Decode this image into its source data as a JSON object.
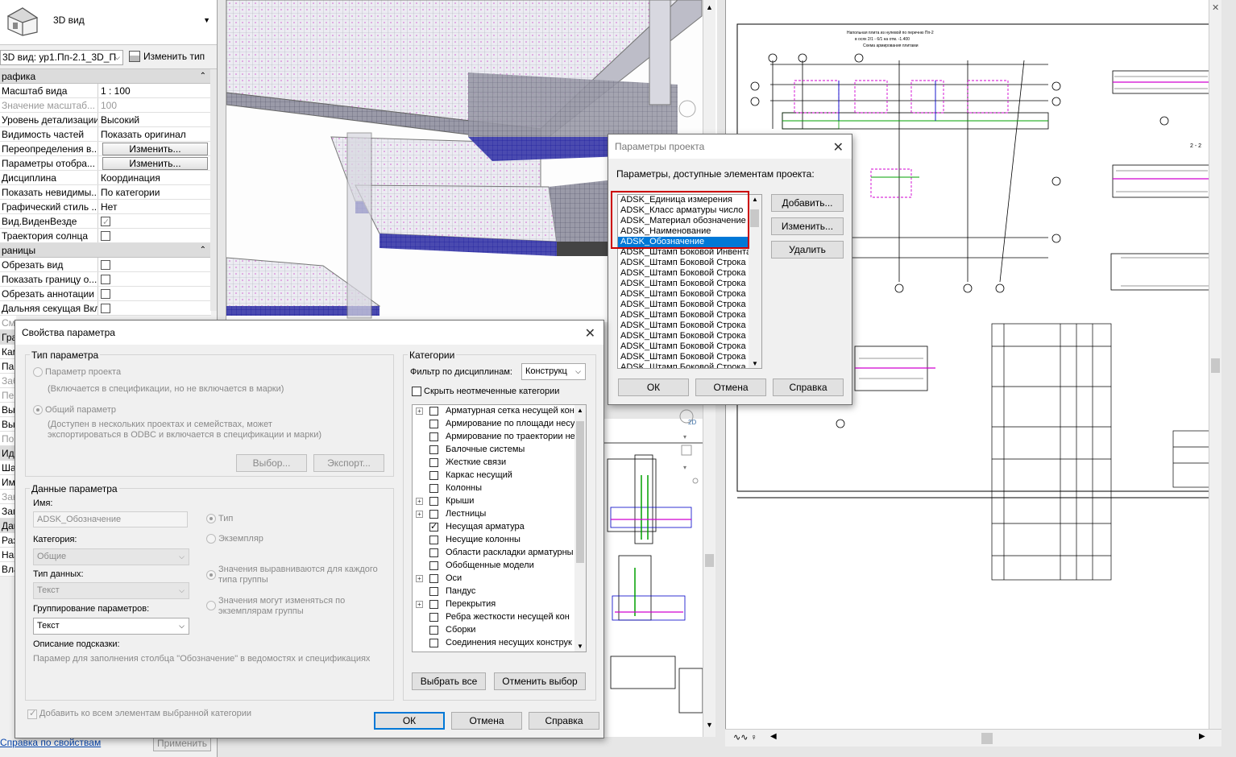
{
  "properties": {
    "type_name": "3D вид",
    "instance_selector": "3D вид: ур1.Пп-2.1_3D_П",
    "edit_type": "Изменить тип",
    "groups": [
      {
        "name": "рафика",
        "rows": [
          {
            "label": "Масштаб вида",
            "value": "1 : 100"
          },
          {
            "label": "Значение масштаб...",
            "value": "100",
            "disabled": true
          },
          {
            "label": "Уровень детализации",
            "value": "Высокий"
          },
          {
            "label": "Видимость частей",
            "value": "Показать оригинал"
          },
          {
            "label": "Переопределения в...",
            "button": "Изменить..."
          },
          {
            "label": "Параметры отобра...",
            "button": "Изменить..."
          },
          {
            "label": "Дисциплина",
            "value": "Координация"
          },
          {
            "label": "Показать невидимы...",
            "value": "По категории"
          },
          {
            "label": "Графический стиль ...",
            "value": "Нет"
          },
          {
            "label": "Вид.ВиденВезде",
            "checkbox": true,
            "checked": true
          },
          {
            "label": "Траектория солнца",
            "checkbox": true,
            "checked": false
          }
        ]
      },
      {
        "name": "раницы",
        "rows": [
          {
            "label": "Обрезать вид",
            "checkbox": true,
            "checked": false
          },
          {
            "label": "Показать границу о...",
            "checkbox": true,
            "checked": false
          },
          {
            "label": "Обрезать аннотации",
            "checkbox": true,
            "checked": false
          },
          {
            "label": "Дальняя секущая Вкл",
            "checkbox": true,
            "checked": false
          }
        ]
      }
    ],
    "clipped_rows": [
      "См",
      "Гра",
      "Кам",
      "Пар",
      "Заб",
      "Пер",
      "Вы",
      "Вы",
      "По",
      "Иде",
      "Ша",
      "Им",
      "Зав",
      "Заг",
      "Дан",
      "Раз",
      "Наз",
      "Вла"
    ],
    "help_link": "Справка по свойствам",
    "apply": "Применить"
  },
  "project_params_dialog": {
    "title": "Параметры проекта",
    "label": "Параметры, доступные элементам проекта:",
    "items": [
      "ADSK_Единица измерения",
      "ADSK_Класс арматуры число",
      "ADSK_Материал обозначение",
      "ADSK_Наименование",
      "ADSK_Обозначение",
      "ADSK_Штамп Боковой Инвента",
      "ADSK_Штамп Боковой Строка 1",
      "ADSK_Штамп Боковой Строка 1",
      "ADSK_Штамп Боковой Строка 2",
      "ADSK_Штамп Боковой Строка 2",
      "ADSK_Штамп Боковой Строка 3",
      "ADSK_Штамп Боковой Строка 3",
      "ADSK_Штамп Боковой Строка 4",
      "ADSK_Штамп Боковой Строка 4",
      "ADSK_Штамп Боковой Строка 5",
      "ADSK_Штамп Боковой Строка 5",
      "ADSK_Штамп Боковой Строка 6"
    ],
    "selected_index": 4,
    "add": "Добавить...",
    "modify": "Изменить...",
    "delete": "Удалить",
    "ok": "ОК",
    "cancel": "Отмена",
    "help": "Справка"
  },
  "param_dialog": {
    "title": "Свойства параметра",
    "param_type_group": "Тип параметра",
    "project_param": "Параметр проекта",
    "project_param_desc": "(Включается в спецификации, но не включается в марки)",
    "shared_param": "Общий параметр",
    "shared_param_desc1": "(Доступен в нескольких проектах и семействах, может",
    "shared_param_desc2": "экспортироваться в ODBC и включается в спецификации и марки)",
    "select_btn": "Выбор...",
    "export_btn": "Экспорт...",
    "data_group": "Данные параметра",
    "name_label": "Имя:",
    "name_value": "ADSK_Обозначение",
    "category_label": "Категория:",
    "category_value": "Общие",
    "datatype_label": "Тип данных:",
    "datatype_value": "Текст",
    "grouping_label": "Группирование параметров:",
    "grouping_value": "Текст",
    "type_radio": "Тип",
    "instance_radio": "Экземпляр",
    "aligned1": "Значения выравниваются для каждого",
    "aligned2": "типа группы",
    "vary1": "Значения могут изменяться по",
    "vary2": "экземплярам группы",
    "tooltip_label": "Описание подсказки:",
    "tooltip_value": "Парамер для заполнения столбца \"Обозначение\" в ведомостях и спецификациях",
    "add_all": "Добавить ко всем элементам выбранной категории",
    "categories_group": "Категории",
    "filter_label": "Фильтр по дисциплинам:",
    "filter_value": "Конструкц",
    "hide_unchecked": "Скрыть неотмеченные категории",
    "categories": [
      {
        "name": "Арматурная сетка несущей кон",
        "expand": true,
        "checked": false
      },
      {
        "name": "Армирование по площади несу",
        "expand": false,
        "checked": false
      },
      {
        "name": "Армирование по траектории не",
        "expand": false,
        "checked": false
      },
      {
        "name": "Балочные системы",
        "expand": false,
        "checked": false
      },
      {
        "name": "Жесткие связи",
        "expand": false,
        "checked": false
      },
      {
        "name": "Каркас несущий",
        "expand": false,
        "checked": false
      },
      {
        "name": "Колонны",
        "expand": false,
        "checked": false
      },
      {
        "name": "Крыши",
        "expand": true,
        "checked": false
      },
      {
        "name": "Лестницы",
        "expand": true,
        "checked": false
      },
      {
        "name": "Несущая арматура",
        "expand": false,
        "checked": true
      },
      {
        "name": "Несущие колонны",
        "expand": false,
        "checked": false
      },
      {
        "name": "Области раскладки арматурны",
        "expand": false,
        "checked": false
      },
      {
        "name": "Обобщенные модели",
        "expand": false,
        "checked": false
      },
      {
        "name": "Оси",
        "expand": true,
        "checked": false
      },
      {
        "name": "Пандус",
        "expand": false,
        "checked": false
      },
      {
        "name": "Перекрытия",
        "expand": true,
        "checked": false
      },
      {
        "name": "Ребра жесткости несущей кон",
        "expand": false,
        "checked": false
      },
      {
        "name": "Сборки",
        "expand": false,
        "checked": false
      },
      {
        "name": "Соединения несущих конструк",
        "expand": false,
        "checked": false
      }
    ],
    "select_all": "Выбрать все",
    "deselect": "Отменить выбор",
    "ok": "ОК",
    "cancel": "Отмена",
    "help": "Справка"
  },
  "drawing": {
    "title_line1": "Напольная плита из нулевой по перечню Пп-2",
    "title_line2": "в осях 2/1 - 6/1 на отм. -1.400",
    "title_line3": "Схема армирования плитами",
    "section": "2 - 2",
    "axes_left": [
      "1",
      "2",
      "3",
      "4",
      "5",
      "6"
    ],
    "axes_letters": [
      "Б",
      "В",
      "Г",
      "Д",
      "Е"
    ]
  },
  "colors": {
    "accent": "#0078d7",
    "highlight_box": "#cc0000",
    "rebar_magenta": "#d000d0",
    "rebar_green": "#00a000",
    "rebar_blue": "#0000c8"
  }
}
